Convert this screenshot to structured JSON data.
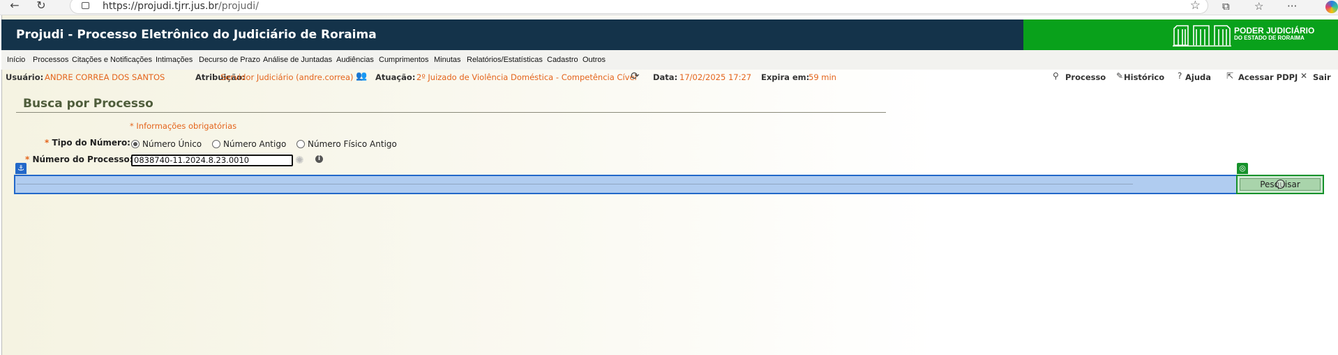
{
  "browser": {
    "url_host": "https://projudi.tjrr.jus.br",
    "url_path": "/projudi/"
  },
  "header": {
    "title": "Projudi - Processo Eletrônico do Judiciário de Roraima",
    "brand_line1": "PODER JUDICIÁRIO",
    "brand_line2": "DO ESTADO DE RORAIMA"
  },
  "menu": {
    "items": [
      "Início",
      "Processos",
      "Citações e Notificações",
      "Intimações",
      "Decurso de Prazo",
      "Análise de Juntadas",
      "Audiências",
      "Cumprimentos",
      "Minutas",
      "Relatórios/Estatísticas",
      "Cadastro",
      "Outros"
    ]
  },
  "info": {
    "usuario_label": "Usuário:",
    "usuario_value": "ANDRE CORREA DOS SANTOS",
    "atribuicao_label": "Atribuição:",
    "atribuicao_value": "Servidor Judiciário (andre.correa)",
    "atuacao_label": "Atuação:",
    "atuacao_value": "2º Juizado de Violência Doméstica - Competência Cível",
    "data_label": "Data:",
    "data_value": "17/02/2025 17:27",
    "expira_label": "Expira em:",
    "expira_value": "59 min"
  },
  "actions": {
    "processo": "Processo",
    "historico": "Histórico",
    "ajuda": "Ajuda",
    "acessar": "Acessar PDPJ",
    "sair": "Sair"
  },
  "form": {
    "section_title": "Busca por Processo",
    "required_note": "* Informações obrigatórias",
    "tipo_label": "Tipo do Número:",
    "radio_unico": "Número Único",
    "radio_antigo": "Número Antigo",
    "radio_fisico": "Número Físico Antigo",
    "selected_radio": "Número Único",
    "numero_label": "Número do Processo:",
    "numero_value": "0838740-11.2024.8.23.0010",
    "search_button": "Pesquisar"
  },
  "colors": {
    "header_bg": "#14334a",
    "brand_bg": "#09a11b",
    "accent_orange": "#e4641b",
    "selection_blue": "#2268c9",
    "button_green": "#16922b"
  }
}
